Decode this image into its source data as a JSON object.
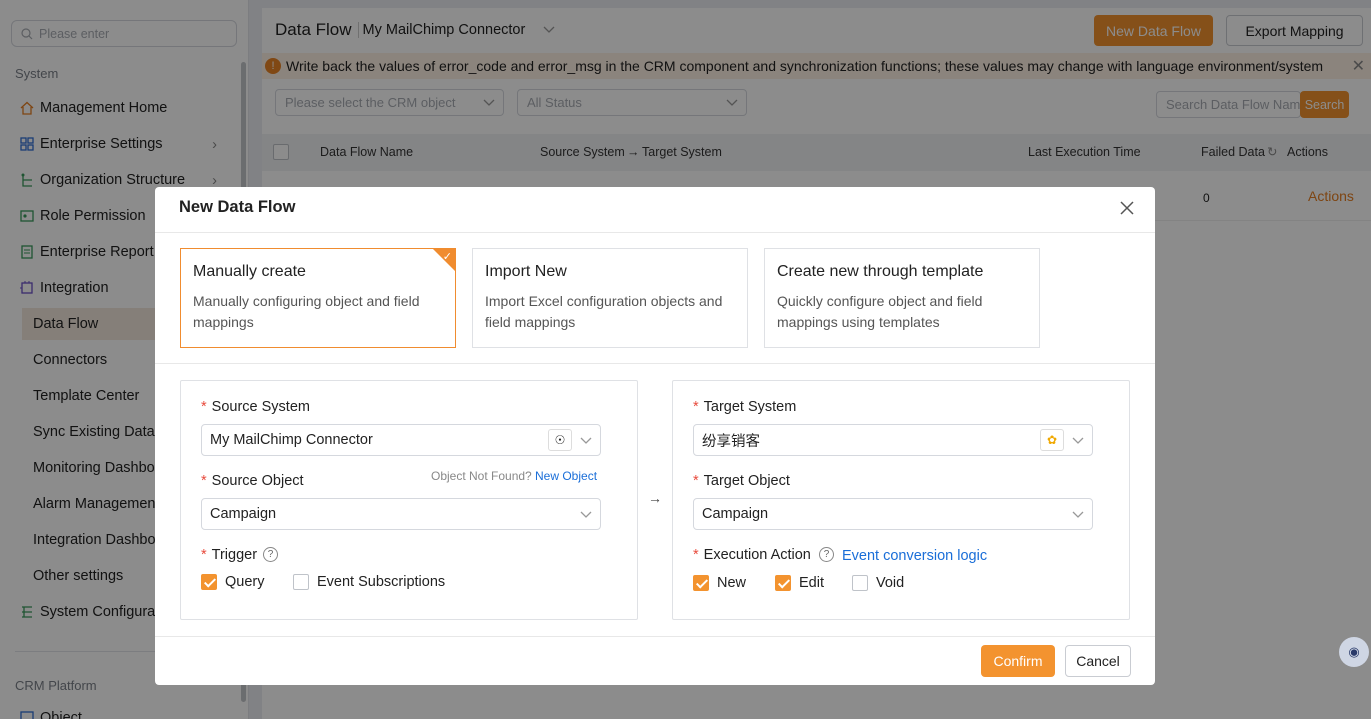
{
  "sidebar": {
    "search_placeholder": "Please enter",
    "section_system": "System",
    "items": [
      {
        "label": "Management Home"
      },
      {
        "label": "Enterprise Settings"
      },
      {
        "label": "Organization Structure"
      },
      {
        "label": "Role Permission"
      },
      {
        "label": "Enterprise Report"
      },
      {
        "label": "Integration"
      }
    ],
    "sub_items": [
      {
        "label": "Data Flow"
      },
      {
        "label": "Connectors"
      },
      {
        "label": "Template Center"
      },
      {
        "label": "Sync Existing Data"
      },
      {
        "label": "Monitoring Dashboard"
      },
      {
        "label": "Alarm Management"
      },
      {
        "label": "Integration Dashboard"
      },
      {
        "label": "Other settings"
      }
    ],
    "system_config": "System Configuration",
    "section_crm": "CRM Platform",
    "object": "Object"
  },
  "header": {
    "title": "Data Flow",
    "connector": "My MailChimp Connector",
    "new_button": "New Data Flow",
    "export_button": "Export Mapping"
  },
  "warning": "Write back the values of error_code and error_msg in the CRM component and synchronization functions; these values may change with language environment/system",
  "filters": {
    "crm_object_placeholder": "Please select the CRM object",
    "status": "All Status",
    "search_placeholder": "Search Data Flow Name",
    "search_button": "Search"
  },
  "table": {
    "headers": [
      "Data Flow Name",
      "Source System",
      "Target System",
      "Last Execution Time",
      "Failed Data",
      "Actions"
    ],
    "row": {
      "failed": "0",
      "actions": "Actions"
    }
  },
  "modal": {
    "title": "New Data Flow",
    "cards": [
      {
        "title": "Manually create",
        "desc": "Manually configuring object and field mappings"
      },
      {
        "title": "Import New",
        "desc": "Import Excel configuration objects and field mappings"
      },
      {
        "title": "Create new through template",
        "desc": "Quickly configure object and field mappings using templates"
      }
    ],
    "source": {
      "system_label": "Source System",
      "system_value": "My MailChimp Connector",
      "object_label": "Source Object",
      "not_found": "Object Not Found?",
      "new_object": "New Object",
      "object_value": "Campaign",
      "trigger_label": "Trigger",
      "query": "Query",
      "event_subscriptions": "Event Subscriptions"
    },
    "target": {
      "system_label": "Target System",
      "system_value": "纷享销客",
      "object_label": "Target Object",
      "object_value": "Campaign",
      "action_label": "Execution Action",
      "event_logic": "Event conversion logic",
      "new": "New",
      "edit": "Edit",
      "void": "Void"
    },
    "confirm": "Confirm",
    "cancel": "Cancel"
  },
  "colors": {
    "accent": "#f3932f",
    "link": "#1a6ed8"
  }
}
